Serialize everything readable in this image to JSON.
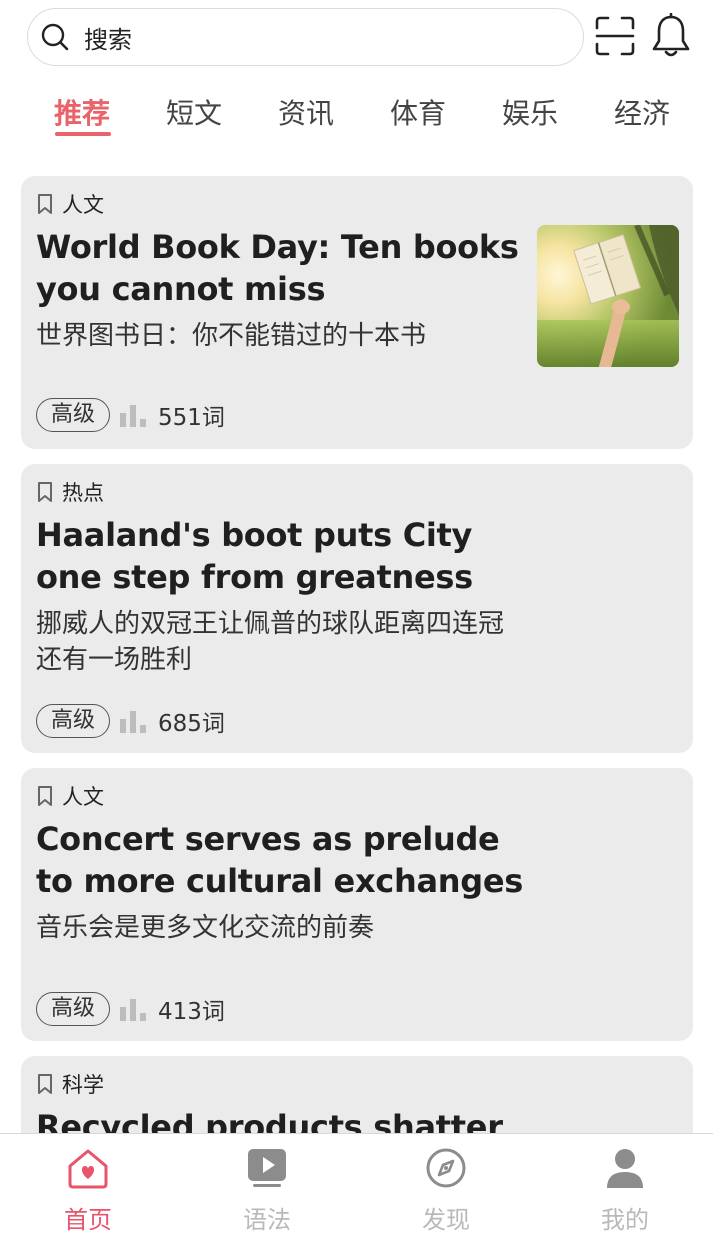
{
  "search": {
    "placeholder": "搜索"
  },
  "header": {
    "scan_icon": "scan-icon",
    "bell_icon": "bell-icon"
  },
  "tabs": [
    {
      "label": "推荐",
      "active": true
    },
    {
      "label": "短文",
      "active": false
    },
    {
      "label": "资讯",
      "active": false
    },
    {
      "label": "体育",
      "active": false
    },
    {
      "label": "娱乐",
      "active": false
    },
    {
      "label": "经济",
      "active": false
    }
  ],
  "colors": {
    "accent": "#e8646a",
    "card_bg": "#ebebeb",
    "inactive_nav": "#b9b9b9"
  },
  "articles": [
    {
      "category": "人文",
      "title": "World Book Day: Ten books you cannot miss",
      "subtitle": "世界图书日：你不能错过的十本书",
      "level": "高级",
      "word_count": "551词",
      "has_image": true
    },
    {
      "category": "热点",
      "title": "Haaland's boot puts City one step from greatness",
      "subtitle": "挪威人的双冠王让佩普的球队距离四连冠还有一场胜利",
      "level": "高级",
      "word_count": "685词",
      "has_image": false
    },
    {
      "category": "人文",
      "title": "Concert serves as prelude to more cultural exchanges",
      "subtitle": "音乐会是更多文化交流的前奏",
      "level": "高级",
      "word_count": "413词",
      "has_image": false
    },
    {
      "category": "科学",
      "title": "Recycled products shatter old",
      "subtitle": "",
      "level": "",
      "word_count": "",
      "has_image": false
    }
  ],
  "bottom_nav": [
    {
      "label": "首页",
      "icon": "home-heart-icon",
      "active": true
    },
    {
      "label": "语法",
      "icon": "video-play-icon",
      "active": false
    },
    {
      "label": "发现",
      "icon": "compass-icon",
      "active": false
    },
    {
      "label": "我的",
      "icon": "user-icon",
      "active": false
    }
  ]
}
